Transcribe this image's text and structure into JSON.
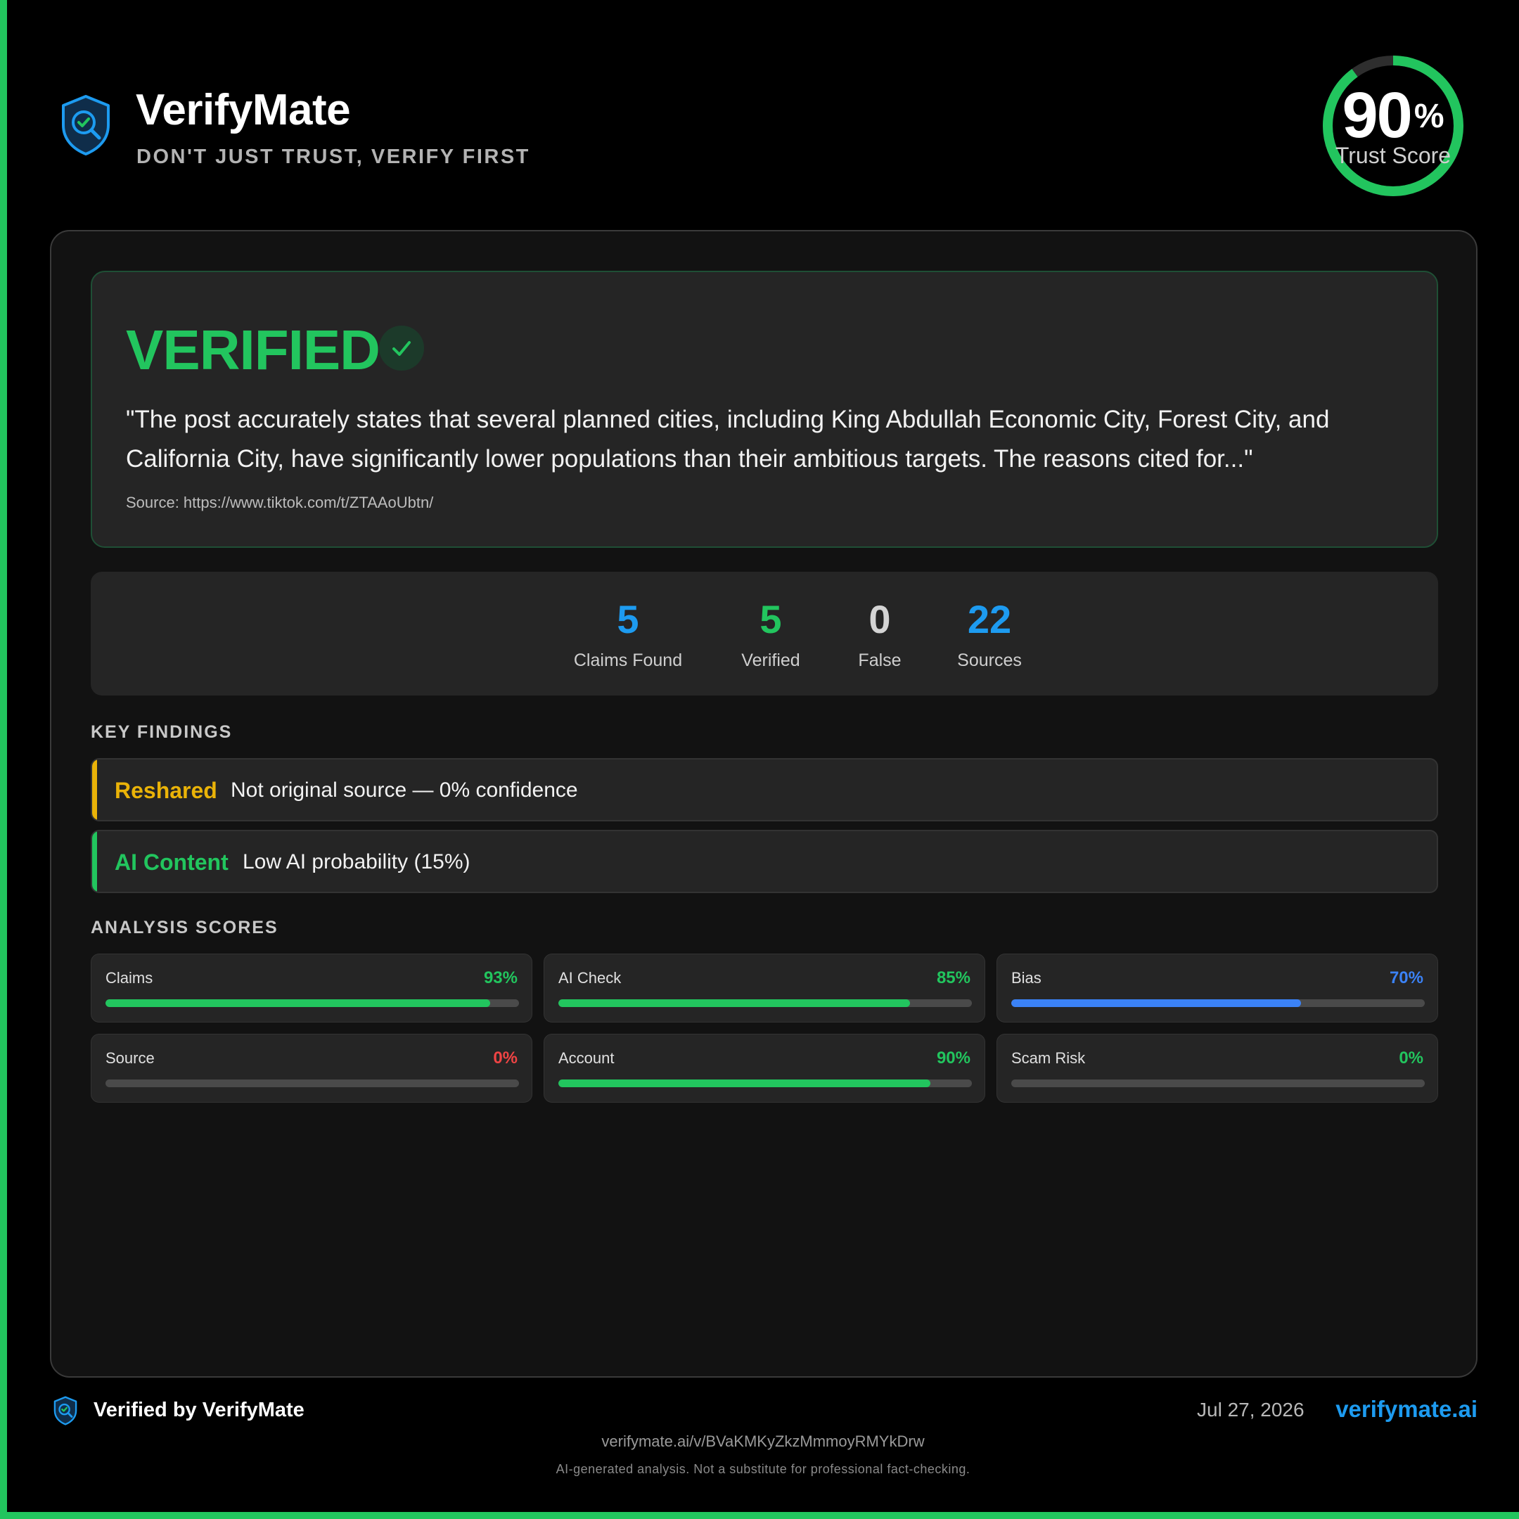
{
  "app": {
    "name": "VerifyMate",
    "tagline": "DON'T JUST TRUST, VERIFY FIRST"
  },
  "trust_score": {
    "value": "90",
    "percent_sign": "%",
    "label": "Trust Score",
    "fraction": 0.9
  },
  "verdict": {
    "title": "VERIFIED",
    "quote": "\"The post accurately states that several planned cities, including King Abdullah Economic City, Forest City, and California City, have significantly lower populations than their ambitious targets. The reasons cited for...\"",
    "source": "Source: https://www.tiktok.com/t/ZTAAoUbtn/"
  },
  "stats": [
    {
      "value": "5",
      "label": "Claims Found",
      "color": "#1d9bf0"
    },
    {
      "value": "5",
      "label": "Verified",
      "color": "#22c55e"
    },
    {
      "value": "0",
      "label": "False",
      "color": "#d4d4d4"
    },
    {
      "value": "22",
      "label": "Sources",
      "color": "#1d9bf0"
    }
  ],
  "key_findings": {
    "title": "KEY FINDINGS",
    "items": [
      {
        "tag": "Reshared",
        "text": "Not original source — 0% confidence",
        "color": "#eab308"
      },
      {
        "tag": "AI Content",
        "text": "Low AI probability (15%)",
        "color": "#22c55e"
      }
    ]
  },
  "analysis_scores": {
    "title": "ANALYSIS SCORES",
    "items": [
      {
        "label": "Claims",
        "value_text": "93%",
        "value": 93,
        "color": "#22c55e"
      },
      {
        "label": "AI Check",
        "value_text": "85%",
        "value": 85,
        "color": "#22c55e"
      },
      {
        "label": "Bias",
        "value_text": "70%",
        "value": 70,
        "color": "#3b82f6"
      },
      {
        "label": "Source",
        "value_text": "0%",
        "value": 0,
        "color": "#ef4444"
      },
      {
        "label": "Account",
        "value_text": "90%",
        "value": 90,
        "color": "#22c55e"
      },
      {
        "label": "Scam Risk",
        "value_text": "0%",
        "value": 0,
        "color": "#22c55e"
      }
    ]
  },
  "footer": {
    "verified_by": "Verified by VerifyMate",
    "date": "Jul 27, 2026",
    "site": "verifymate.ai",
    "link": "verifymate.ai/v/BVaKMKyZkzMmmoyRMYkDrw",
    "disclaimer": "AI-generated analysis. Not a substitute for professional fact-checking."
  },
  "colors": {
    "accent_green": "#22c55e",
    "accent_blue": "#1d9bf0",
    "background": "#000000"
  },
  "icons": {
    "brand": "shield-check-search-icon",
    "verdict": "check-icon"
  }
}
